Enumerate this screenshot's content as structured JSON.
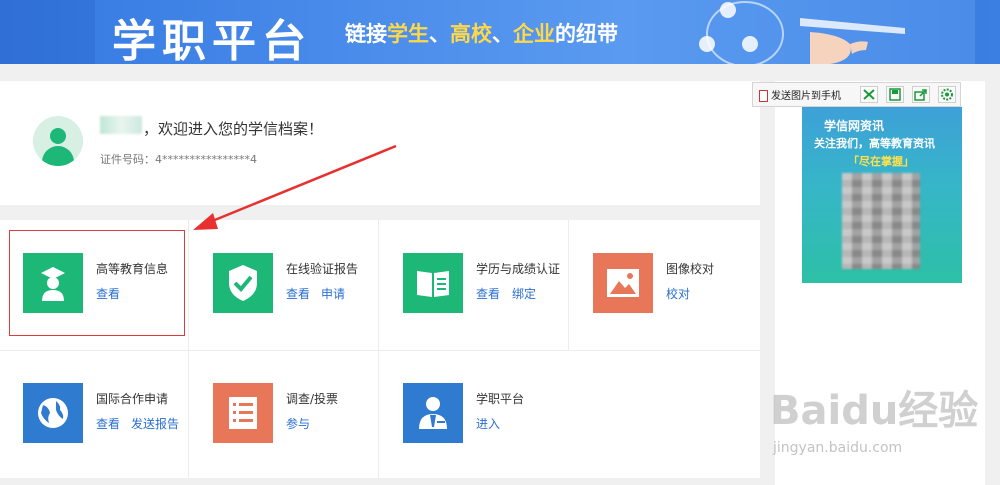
{
  "banner": {
    "brand": "学职平台",
    "slogan_prefix": "链接",
    "slogan_student": "学生",
    "slogan_sep1": "、",
    "slogan_school": "高校",
    "slogan_sep2": "、",
    "slogan_company": "企业",
    "slogan_suffix": "的纽带"
  },
  "profile": {
    "welcome": "，欢迎进入您的学信档案！",
    "id_label": "证件号码：4****************4"
  },
  "tiles": [
    {
      "title": "高等教育信息",
      "icon": "graduate-icon",
      "color": "#1db778",
      "links": [
        "查看"
      ]
    },
    {
      "title": "在线验证报告",
      "icon": "shield-check-icon",
      "color": "#1db778",
      "links": [
        "查看",
        "申请"
      ]
    },
    {
      "title": "学历与成绩认证",
      "icon": "book-icon",
      "color": "#1db778",
      "links": [
        "查看",
        "绑定"
      ]
    },
    {
      "title": "图像校对",
      "icon": "image-icon",
      "color": "#e8775a",
      "links": [
        "校对"
      ]
    },
    {
      "title": "国际合作申请",
      "icon": "globe-icon",
      "color": "#2f7bd0",
      "links": [
        "查看",
        "发送报告"
      ]
    },
    {
      "title": "调查/投票",
      "icon": "list-icon",
      "color": "#e8775a",
      "links": [
        "参与"
      ]
    },
    {
      "title": "学职平台",
      "icon": "person-card-icon",
      "color": "#2f7bd0",
      "links": [
        "进入"
      ]
    }
  ],
  "toolbar": {
    "send_label": "发送图片到手机"
  },
  "ad": {
    "title": "学信网资讯",
    "subtitle": "关注我们，高等教育资讯",
    "tag": "「尽在掌握」"
  },
  "watermark": {
    "main": "Baidu经验",
    "sub": "jingyan.baidu.com"
  }
}
